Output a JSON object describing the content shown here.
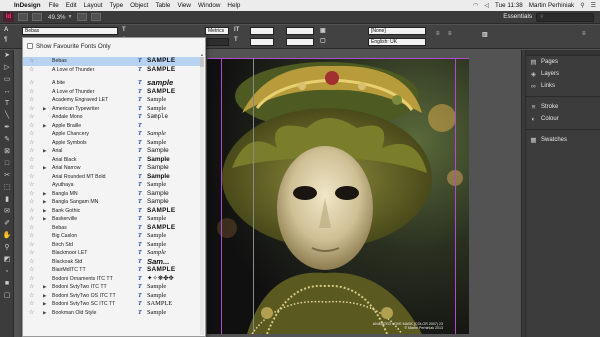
{
  "menubar": {
    "app_name": "InDesign",
    "items": [
      "File",
      "Edit",
      "Layout",
      "Type",
      "Object",
      "Table",
      "View",
      "Window",
      "Help"
    ],
    "clock": "Tue 11:38",
    "user": "Martin Perhiniak"
  },
  "appbar": {
    "logo": "Id",
    "zoom": "49.3%",
    "workspace": "Essentials"
  },
  "control": {
    "font_family": "Bebas",
    "size_value": "Metrics",
    "language": "English: UK",
    "style_none": "[None]"
  },
  "font_menu": {
    "favourites_label": "Show Favourite Fonts Only",
    "fonts": [
      {
        "name": "Bebas",
        "sample": "SAMPLE",
        "style": "s-caps",
        "expand": false,
        "selected": true
      },
      {
        "name": "A Love of Thunder",
        "sample": "SAMPLE",
        "style": "s-caps",
        "expand": false,
        "selected": false
      },
      {
        "name": "",
        "sample": "",
        "style": "",
        "expand": false,
        "selected": false
      },
      {
        "name": "A bite",
        "sample": "sample",
        "style": "s-heavy",
        "expand": false,
        "selected": false
      },
      {
        "name": "A Love of Thunder",
        "sample": "SAMPLE",
        "style": "s-caps",
        "expand": false,
        "selected": false
      },
      {
        "name": "Academy Engraved LET",
        "sample": "Sample",
        "style": "s-serif",
        "expand": false,
        "selected": false
      },
      {
        "name": "American Typewriter",
        "sample": "Sample",
        "style": "s-serif",
        "expand": true,
        "selected": false
      },
      {
        "name": "Andale Mono",
        "sample": "Sample",
        "style": "s-mono",
        "expand": false,
        "selected": false
      },
      {
        "name": "Apple Braille",
        "sample": "",
        "style": "",
        "expand": true,
        "selected": false
      },
      {
        "name": "Apple Chancery",
        "sample": "Sample",
        "style": "s-italic",
        "expand": false,
        "selected": false
      },
      {
        "name": "Apple Symbols",
        "sample": "Sample",
        "style": "s-serif",
        "expand": false,
        "selected": false
      },
      {
        "name": "Arial",
        "sample": "Sample",
        "style": "",
        "expand": true,
        "selected": false
      },
      {
        "name": "Arial Black",
        "sample": "Sample",
        "style": "s-bold",
        "expand": false,
        "selected": false
      },
      {
        "name": "Arial Narrow",
        "sample": "Sample",
        "style": "",
        "expand": true,
        "selected": false
      },
      {
        "name": "Arial Rounded MT Bold",
        "sample": "Sample",
        "style": "s-bold",
        "expand": false,
        "selected": false
      },
      {
        "name": "Ayuthaya",
        "sample": "Sample",
        "style": "s-serif",
        "expand": false,
        "selected": false
      },
      {
        "name": "Bangla MN",
        "sample": "Sample",
        "style": "",
        "expand": true,
        "selected": false
      },
      {
        "name": "Bangla Sangam MN",
        "sample": "Sample",
        "style": "",
        "expand": true,
        "selected": false
      },
      {
        "name": "Bank Gothic",
        "sample": "SAMPLE",
        "style": "s-caps",
        "expand": true,
        "selected": false
      },
      {
        "name": "Baskerville",
        "sample": "Sample",
        "style": "s-serif",
        "expand": true,
        "selected": false
      },
      {
        "name": "Bebas",
        "sample": "SAMPLE",
        "style": "s-caps",
        "expand": false,
        "selected": false
      },
      {
        "name": "Big Caslon",
        "sample": "Sample",
        "style": "s-serif",
        "expand": false,
        "selected": false
      },
      {
        "name": "Birch Std",
        "sample": "Sample",
        "style": "s-serif",
        "expand": false,
        "selected": false
      },
      {
        "name": "Blackmoor LET",
        "sample": "Sample",
        "style": "s-italic",
        "expand": false,
        "selected": false
      },
      {
        "name": "Blackoak Std",
        "sample": "Sam...",
        "style": "s-heavy",
        "expand": false,
        "selected": false
      },
      {
        "name": "BlairMdITC TT",
        "sample": "SAMPLE",
        "style": "s-caps",
        "expand": false,
        "selected": false
      },
      {
        "name": "Bodoni Ornaments ITC TT",
        "sample": "✦✧❋✤✥",
        "style": "",
        "expand": false,
        "selected": false
      },
      {
        "name": "Bodoni SvtyTwo ITC TT",
        "sample": "Sample",
        "style": "s-serif",
        "expand": true,
        "selected": false
      },
      {
        "name": "Bodoni SvtyTwo OS ITC TT",
        "sample": "Sample",
        "style": "s-serif",
        "expand": true,
        "selected": false
      },
      {
        "name": "Bodoni SvtyTwo SC ITC TT",
        "sample": "SAMPLE",
        "style": "s-serif",
        "expand": true,
        "selected": false
      },
      {
        "name": "Bookman Old Style",
        "sample": "Sample",
        "style": "s-serif",
        "expand": true,
        "selected": false
      }
    ]
  },
  "credit": {
    "line1": "ANIMATED LOVE MASK (COLOR 2007) 23",
    "line2": "© Martin Perhiniak 2013"
  },
  "panels": {
    "group1": [
      {
        "icon": "pages-icon",
        "glyph": "▤",
        "label": "Pages"
      },
      {
        "icon": "layers-icon",
        "glyph": "◈",
        "label": "Layers"
      },
      {
        "icon": "links-icon",
        "glyph": "∞",
        "label": "Links"
      }
    ],
    "group2": [
      {
        "icon": "stroke-icon",
        "glyph": "≡",
        "label": "Stroke"
      },
      {
        "icon": "colour-icon",
        "glyph": "◐",
        "label": "Colour"
      }
    ],
    "group3": [
      {
        "icon": "swatches-icon",
        "glyph": "▦",
        "label": "Swatches"
      }
    ]
  },
  "colors": {
    "accent_menu_selection": "#b8d3f2",
    "margin_guide": "#b04bd0",
    "app_bar": "#3b3b3b"
  }
}
